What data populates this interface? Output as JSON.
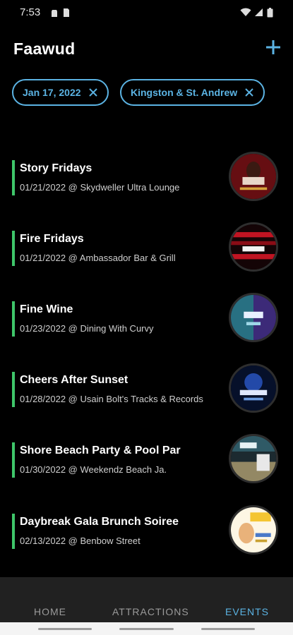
{
  "status_bar": {
    "time": "7:53"
  },
  "header": {
    "title": "Faawud"
  },
  "filters": [
    {
      "label": "Jan 17, 2022"
    },
    {
      "label": "Kingston & St. Andrew"
    }
  ],
  "events": [
    {
      "name": "Story Fridays",
      "details": "01/21/2022 @ Skydweller Ultra Lounge"
    },
    {
      "name": "Fire Fridays",
      "details": "01/21/2022 @ Ambassador Bar & Grill"
    },
    {
      "name": "Fine Wine",
      "details": "01/23/2022 @ Dining With Curvy"
    },
    {
      "name": "Cheers After Sunset",
      "details": "01/28/2022 @ Usain Bolt's Tracks & Records"
    },
    {
      "name": "Shore Beach Party & Pool Par",
      "details": "01/30/2022 @ Weekendz Beach Ja."
    },
    {
      "name": "Daybreak Gala Brunch Soiree",
      "details": "02/13/2022 @ Benbow Street"
    }
  ],
  "bottom_nav": {
    "home": "HOME",
    "attractions": "ATTRACTIONS",
    "events": "EVENTS"
  },
  "colors": {
    "accent": "#5bb3e3",
    "event_bar": "#3fc66a",
    "background": "#000000",
    "nav_background": "#212121"
  }
}
